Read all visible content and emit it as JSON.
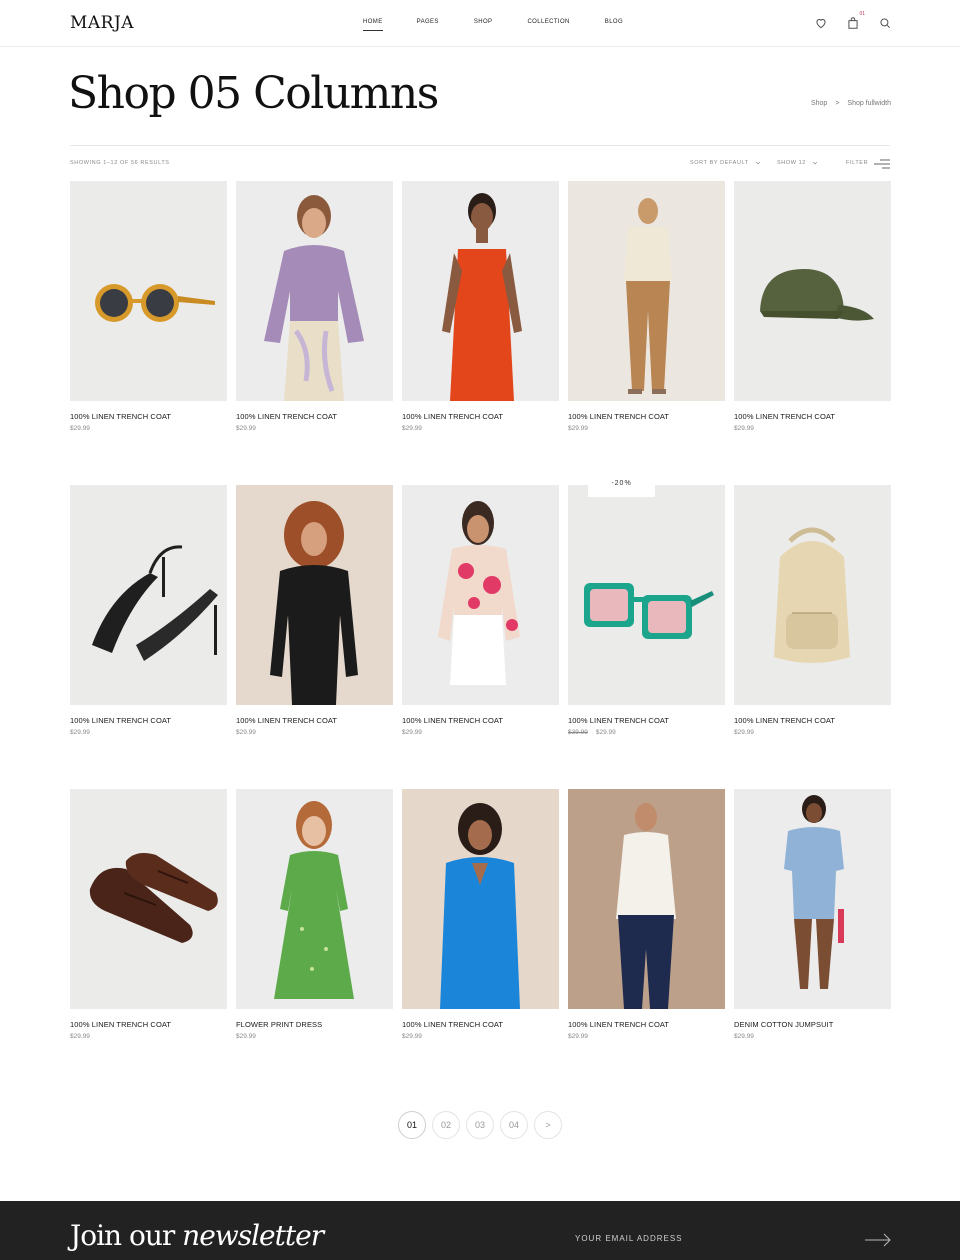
{
  "header": {
    "logo": "MARJA",
    "nav": [
      {
        "label": "HOME",
        "active": true
      },
      {
        "label": "PAGES",
        "active": false
      },
      {
        "label": "SHOP",
        "active": false
      },
      {
        "label": "COLLECTION",
        "active": false
      },
      {
        "label": "BLOG",
        "active": false
      }
    ],
    "icons": [
      "heart-icon",
      "shopping-bag-icon",
      "search-icon"
    ],
    "cart_count": "01"
  },
  "page": {
    "title": "Shop 05 Columns",
    "breadcrumb": [
      "Shop",
      ">",
      "Shop fullwidth"
    ]
  },
  "toolbar": {
    "results": "SHOWING 1–12 OF 56 RESULTS",
    "sort": "SORT BY DEFAULT",
    "show": "SHOW 12",
    "filter": "FILTER"
  },
  "products": [
    {
      "name": "100% LINEN TRENCH COAT",
      "price": "$29.99",
      "image": "sunglasses"
    },
    {
      "name": "100% LINEN TRENCH COAT",
      "price": "$29.99",
      "image": "lilac-cardigan"
    },
    {
      "name": "100% LINEN TRENCH COAT",
      "price": "$29.99",
      "image": "orange-jumpsuit"
    },
    {
      "name": "100% LINEN TRENCH COAT",
      "price": "$29.99",
      "image": "beige-cardigan-outfit"
    },
    {
      "name": "100% LINEN TRENCH COAT",
      "price": "$29.99",
      "image": "green-cap"
    },
    {
      "name": "100% LINEN TRENCH COAT",
      "price": "$29.99",
      "image": "black-sandals"
    },
    {
      "name": "100% LINEN TRENCH COAT",
      "price": "$29.99",
      "image": "black-cardigan"
    },
    {
      "name": "100% LINEN TRENCH COAT",
      "price": "$29.99",
      "image": "floral-shirt"
    },
    {
      "name": "100% LINEN TRENCH COAT",
      "price": "$29.99",
      "old_price": "$39.99",
      "badge": "-20%",
      "image": "green-sunglasses"
    },
    {
      "name": "100% LINEN TRENCH COAT",
      "price": "$29.99",
      "image": "beige-backpack"
    },
    {
      "name": "100% LINEN TRENCH COAT",
      "price": "$29.99",
      "image": "brown-loafers"
    },
    {
      "name": "FLOWER PRINT DRESS",
      "price": "$29.99",
      "image": "green-dress"
    },
    {
      "name": "100% LINEN TRENCH COAT",
      "price": "$29.99",
      "image": "blue-dress"
    },
    {
      "name": "100% LINEN TRENCH COAT",
      "price": "$29.99",
      "image": "white-shirt-man"
    },
    {
      "name": "DENIM COTTON JUMPSUIT",
      "price": "$29.99",
      "image": "denim-jumpsuit"
    }
  ],
  "pagination": {
    "pages": [
      "01",
      "02",
      "03",
      "04"
    ],
    "current": "01",
    "next": ">"
  },
  "newsletter": {
    "title_plain": "Join our",
    "title_italic": "newsletter",
    "placeholder": "YOUR EMAIL ADDRESS"
  },
  "colors": {
    "accent": "#c0395a",
    "footer_bg": "#222222"
  }
}
